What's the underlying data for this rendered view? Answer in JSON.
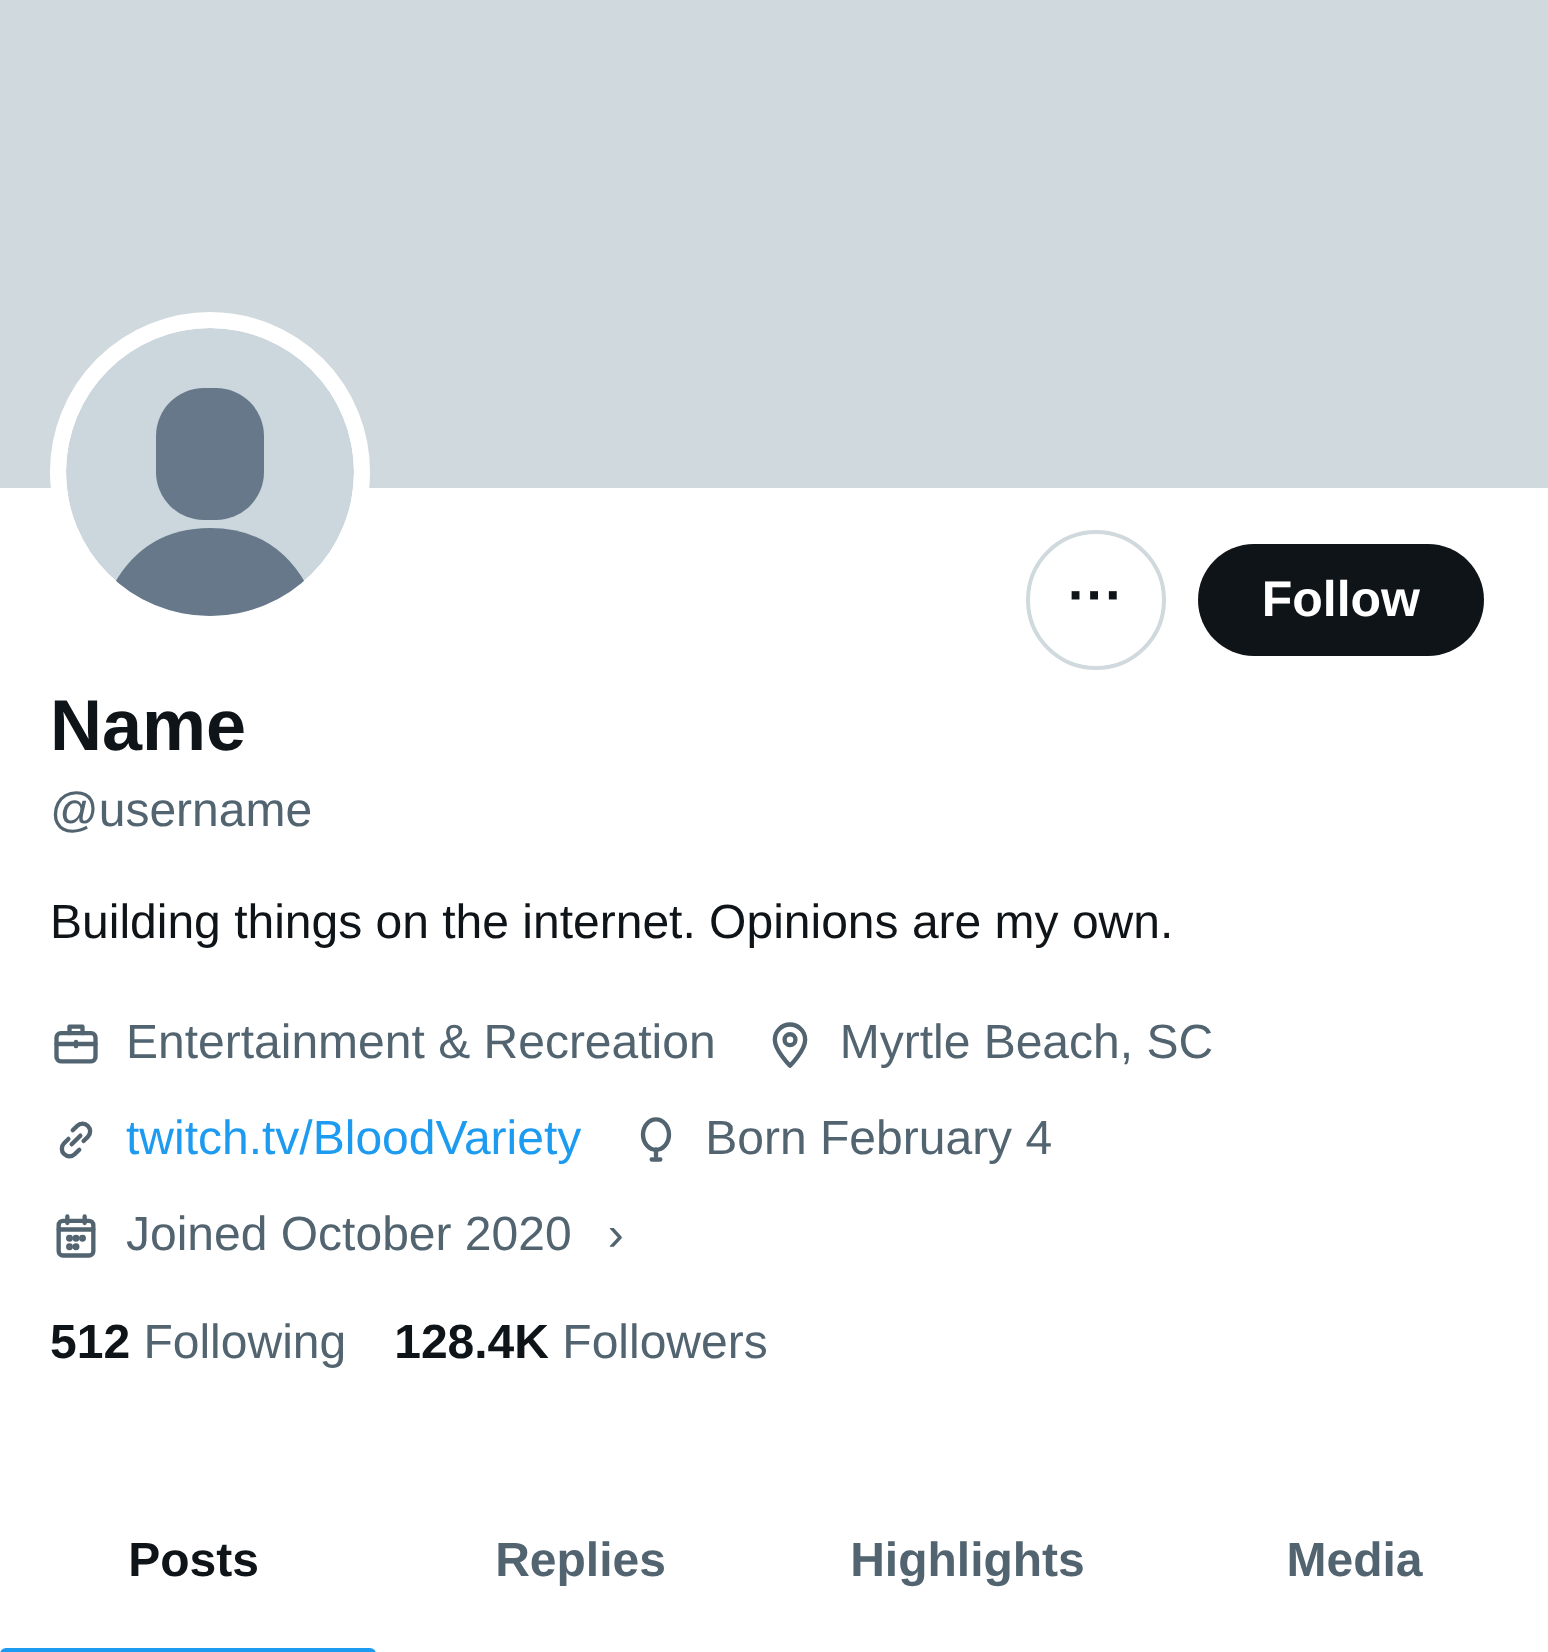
{
  "profile": {
    "name": "Name",
    "username": "@username",
    "bio": "Building things on the internet. Opinions are my own."
  },
  "actions": {
    "more": "···",
    "follow": "Follow"
  },
  "detail_rows": [
    {
      "items": [
        {
          "kind": "category",
          "text": "Entertainment & Recreation"
        },
        {
          "kind": "location",
          "text": "Myrtle Beach, SC"
        }
      ]
    },
    {
      "items": [
        {
          "kind": "link",
          "text": "twitch.tv/BloodVariety"
        },
        {
          "kind": "birthday",
          "text": "Born February 4"
        }
      ]
    },
    {
      "items": [
        {
          "kind": "joined",
          "text": "Joined October 2020",
          "chevron": "›"
        }
      ]
    }
  ],
  "stats": [
    {
      "count": "512",
      "label": "Following"
    },
    {
      "count": "128.4K",
      "label": "Followers"
    }
  ],
  "tabs": [
    {
      "label": "Posts",
      "selected": true
    },
    {
      "label": "Replies",
      "selected": false
    },
    {
      "label": "Highlights",
      "selected": false
    },
    {
      "label": "Media",
      "selected": false
    }
  ]
}
